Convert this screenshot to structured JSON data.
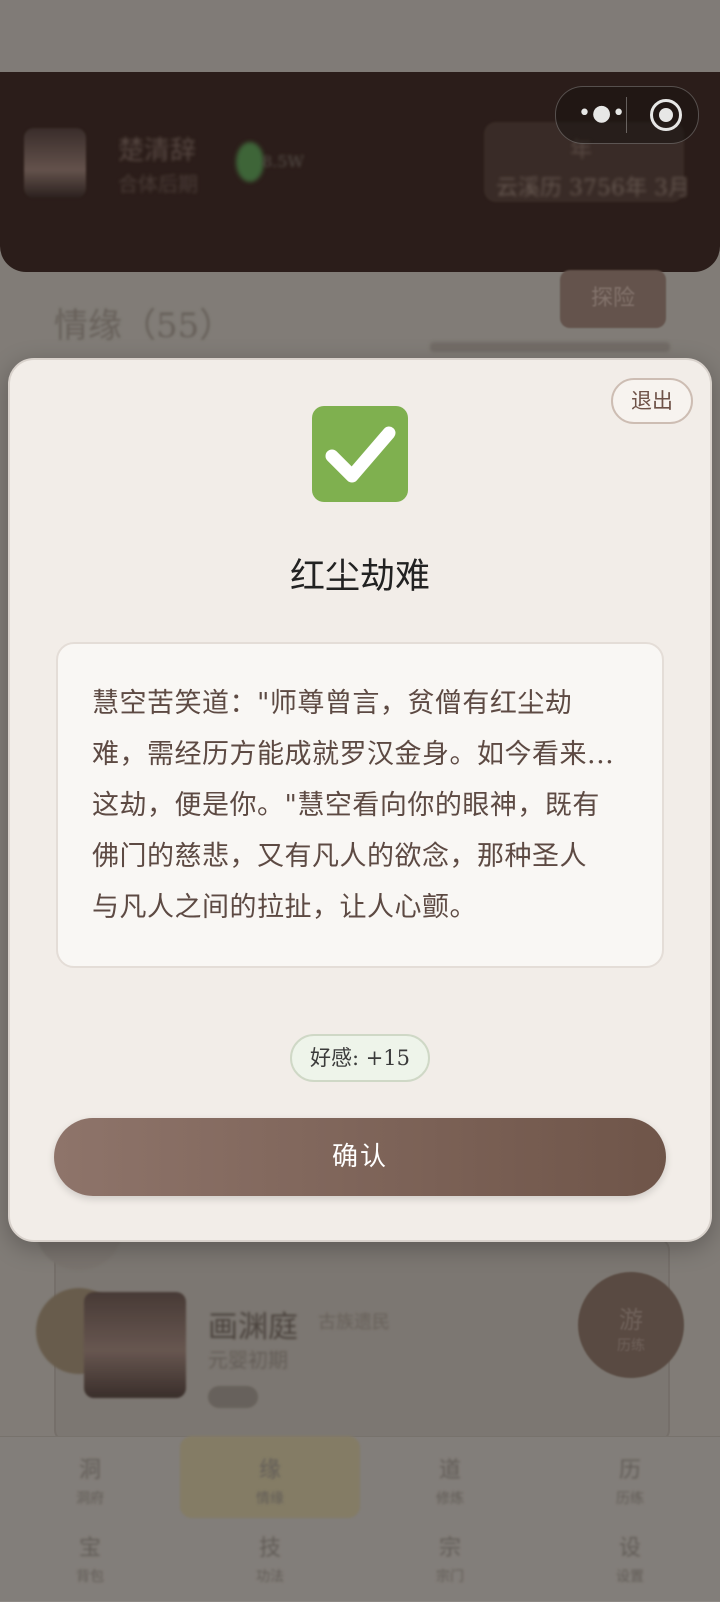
{
  "background": {
    "header": {
      "name": "楚清辞",
      "realm": "合体后期",
      "spirit_stones": "8.5W",
      "date_label": "年",
      "date": "云溪历 3756年 3月"
    },
    "section_title": "情缘（55）",
    "explore_label": "探险",
    "card": {
      "name": "画渊庭",
      "tag": "古族遗民",
      "realm": "元婴初期"
    },
    "float_button": {
      "label": "游",
      "sub": "历练"
    },
    "bottom_nav": [
      {
        "icon": "洞",
        "label": "洞府"
      },
      {
        "icon": "缘",
        "label": "情缘"
      },
      {
        "icon": "道",
        "label": "修炼"
      },
      {
        "icon": "历",
        "label": "历练"
      },
      {
        "icon": "宝",
        "label": "背包"
      },
      {
        "icon": "技",
        "label": "功法"
      },
      {
        "icon": "宗",
        "label": "宗门"
      },
      {
        "icon": "设",
        "label": "设置"
      }
    ]
  },
  "capsule": {
    "more_icon": "more-dots-icon",
    "close_icon": "target-icon"
  },
  "modal": {
    "exit_label": "退出",
    "icon": "check-mark-icon",
    "icon_color": "#7fb04f",
    "title": "红尘劫难",
    "story_lines": [
      "慧空苦笑道：\"师尊曾言，贫僧有红尘劫",
      "难，需经历方能成就罗汉金身。如今看来...",
      "这劫，便是你。\"慧空看向你的眼神，既有",
      "佛门的慈悲，又有凡人的欲念，那种圣人",
      "与凡人之间的拉扯，让人心颤。"
    ],
    "favor_text": "好感: +15",
    "confirm_label": "确认"
  }
}
